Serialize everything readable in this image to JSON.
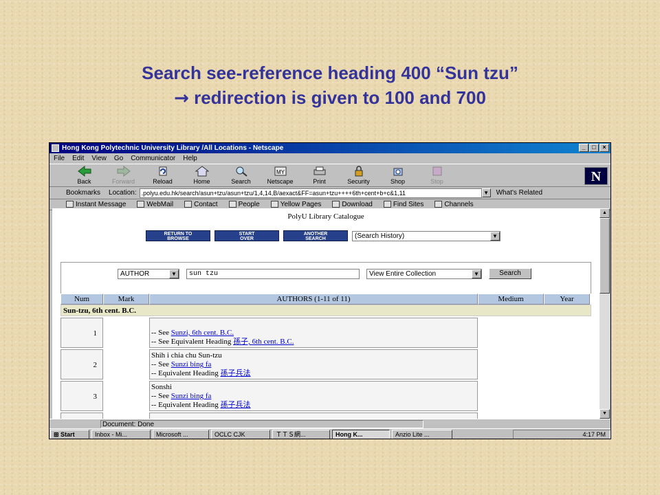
{
  "slide": {
    "title_line1": "Search see-reference heading 400 “Sun tzu”",
    "title_arrow": "→",
    "title_line2": " redirection is given to 100 and 700"
  },
  "window": {
    "title": "Hong Kong Polytechnic University Library /All Locations - Netscape",
    "menu": [
      "File",
      "Edit",
      "View",
      "Go",
      "Communicator",
      "Help"
    ],
    "toolbar": [
      {
        "label": "Back",
        "icon": "back-arrow-icon",
        "enabled": true
      },
      {
        "label": "Forward",
        "icon": "forward-arrow-icon",
        "enabled": false
      },
      {
        "label": "Reload",
        "icon": "reload-icon",
        "enabled": true
      },
      {
        "label": "Home",
        "icon": "home-icon",
        "enabled": true
      },
      {
        "label": "Search",
        "icon": "search-icon",
        "enabled": true
      },
      {
        "label": "Netscape",
        "icon": "netscape-icon",
        "enabled": true
      },
      {
        "label": "Print",
        "icon": "printer-icon",
        "enabled": true
      },
      {
        "label": "Security",
        "icon": "lock-icon",
        "enabled": true
      },
      {
        "label": "Shop",
        "icon": "shop-icon",
        "enabled": true
      },
      {
        "label": "Stop",
        "icon": "stop-icon",
        "enabled": false
      }
    ],
    "location": {
      "bookmarks_label": "Bookmarks",
      "location_label": "Location:",
      "url": ".polyu.edu.hk/search/asun+tzu/asun+tzu/1,4,14,B/aexact&FF=asun+tzu++++6th+cent+b+c&1,11",
      "related_label": "What's Related"
    },
    "personal_bar": [
      "Instant Message",
      "WebMail",
      "Contact",
      "People",
      "Yellow Pages",
      "Download",
      "Find Sites",
      "Channels"
    ],
    "status": "Document: Done"
  },
  "catalogue": {
    "title": "PolyU Library Catalogue",
    "buttons": [
      {
        "line1": "RETURN TO",
        "line2": "BROWSE"
      },
      {
        "line1": "START",
        "line2": "OVER"
      },
      {
        "line1": "ANOTHER",
        "line2": "SEARCH"
      }
    ],
    "history_select": "(Search History)",
    "search": {
      "field_type": "AUTHOR",
      "query": "sun tzu",
      "collection": "View Entire Collection",
      "button": "Search"
    },
    "columns": [
      "Num",
      "Mark",
      "AUTHORS (1-11 of 11)",
      "Medium",
      "Year"
    ],
    "group_heading": "Sun-tzu, 6th cent. B.C.",
    "rows": [
      {
        "num": "1",
        "lines": [
          {
            "prefix": "-- See ",
            "link": "Sunzi, 6th cent. B.C."
          },
          {
            "prefix": "-- See Equivalent Heading ",
            "link": "孫子, 6th cent. B.C."
          }
        ]
      },
      {
        "num": "2",
        "heading": "Shih i chia chu Sun-tzu",
        "lines": [
          {
            "prefix": "-- See ",
            "link": "Sunzi bing fa"
          },
          {
            "prefix": "-- Equivalent Heading ",
            "link": "孫子兵法"
          }
        ]
      },
      {
        "num": "3",
        "heading": "Sonshi",
        "lines": [
          {
            "prefix": "-- See ",
            "link": "Sunzi bing fa"
          },
          {
            "prefix": "-- Equivalent Heading ",
            "link": "孫子兵法"
          }
        ]
      }
    ]
  },
  "taskbar": {
    "start": "Start",
    "tasks": [
      "Inbox - Mi...",
      "Microsoft ...",
      "OCLC CJK",
      "ＴＴＳ網...",
      "Hong K...",
      "Anzio Lite ..."
    ],
    "active_index": 4,
    "clock": "4:17 PM"
  }
}
